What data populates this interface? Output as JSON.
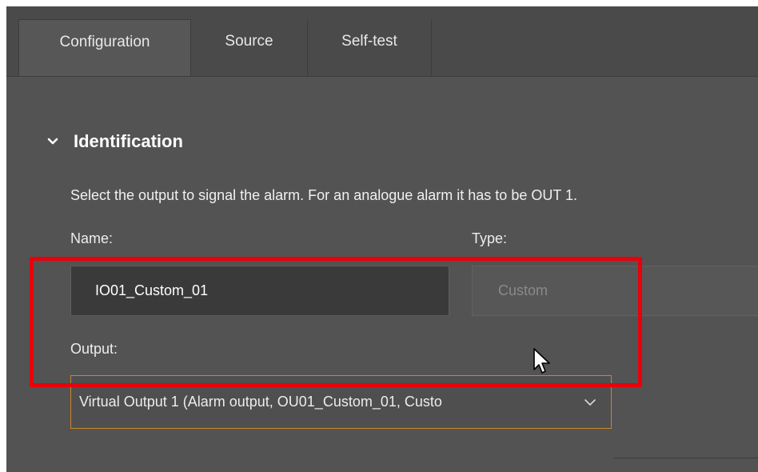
{
  "tabs": [
    {
      "label": "Configuration",
      "active": true
    },
    {
      "label": "Source",
      "active": false
    },
    {
      "label": "Self-test",
      "active": false
    }
  ],
  "section": {
    "title": "Identification",
    "expanded": true,
    "description": "Select the output to signal the alarm. For an analogue alarm it has to be OUT 1."
  },
  "fields": {
    "name_label": "Name:",
    "name_value": "IO01_Custom_01",
    "type_label": "Type:",
    "type_value": "Custom",
    "output_label": "Output:",
    "output_value": "Virtual Output 1 (Alarm output, OU01_Custom_01, Custo"
  },
  "colors": {
    "background": "#535353",
    "tab_bar": "#4a4a4a",
    "focus_border": "#c9862b",
    "annotation_highlight": "#e8000b"
  },
  "icons": {
    "section_toggle": "chevron-down-icon",
    "output_dropdown": "chevron-down-icon",
    "pointer": "mouse-cursor-icon"
  }
}
